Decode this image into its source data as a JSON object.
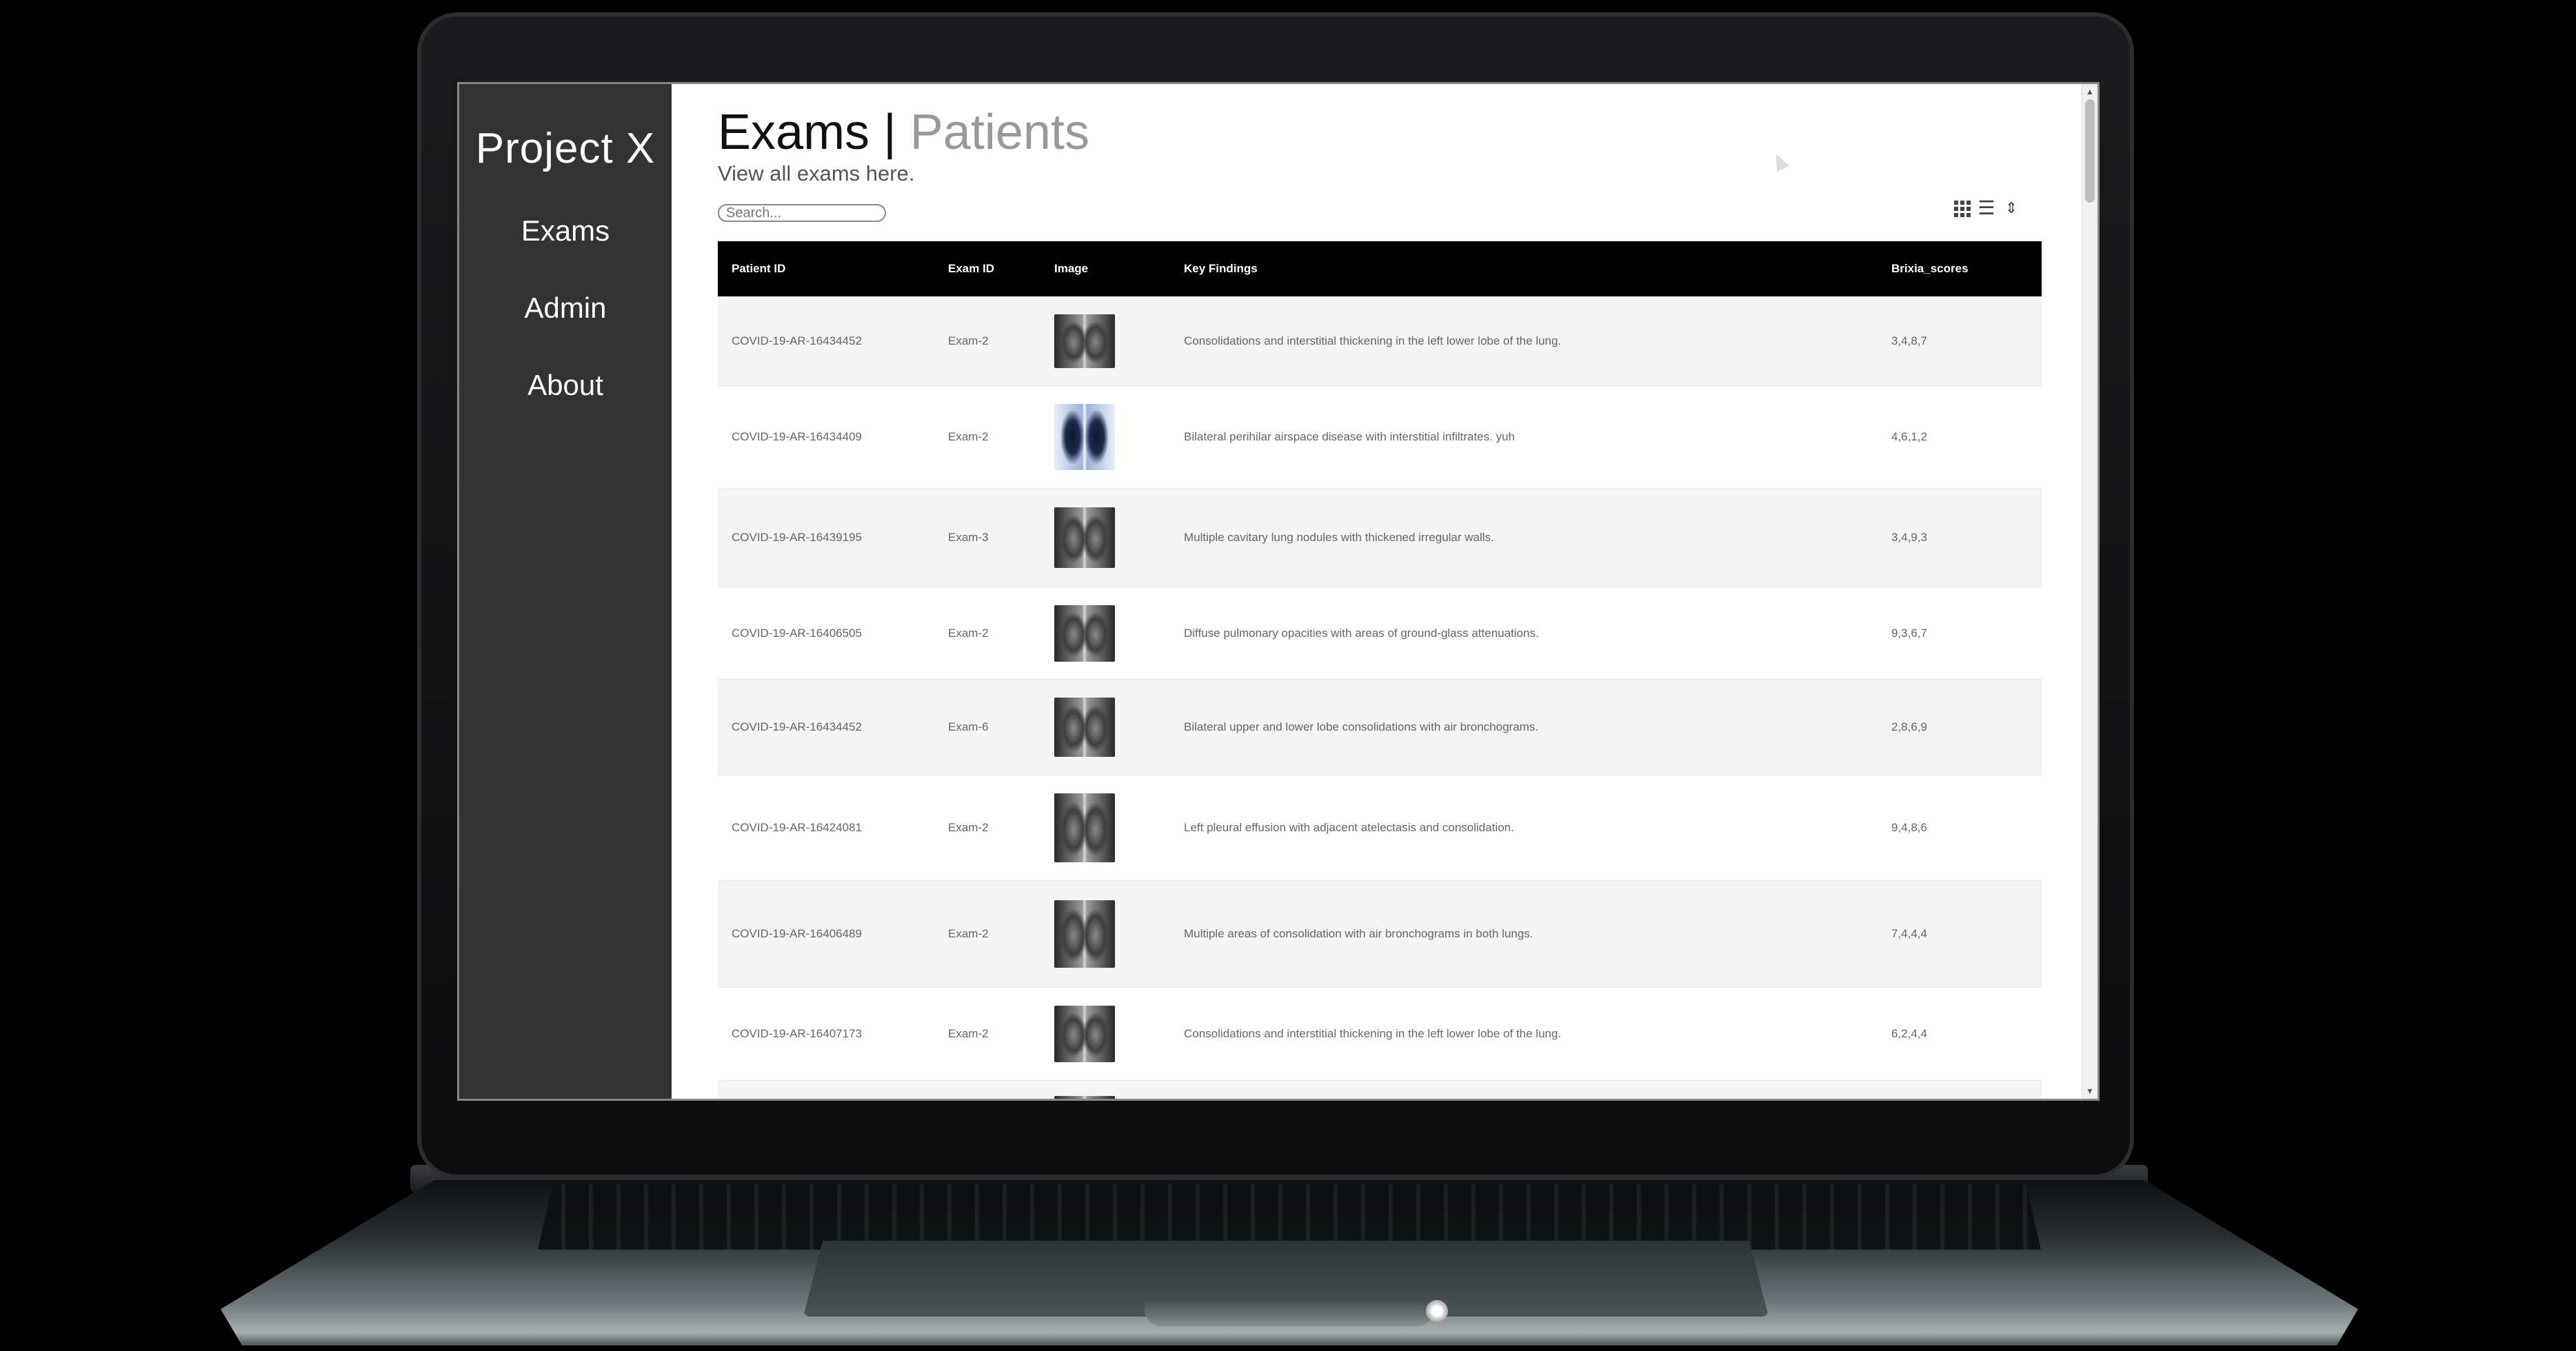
{
  "brand": "Project X",
  "nav": [
    {
      "label": "Exams"
    },
    {
      "label": "Admin"
    },
    {
      "label": "About"
    }
  ],
  "header": {
    "title_active": "Exams",
    "separator": "|",
    "title_inactive": "Patients",
    "subtitle": "View all exams here."
  },
  "search": {
    "placeholder": "Search..."
  },
  "view_toggles": {
    "icons": [
      "grid-icon",
      "list-icon",
      "sort-icon"
    ]
  },
  "table": {
    "columns": [
      "Patient ID",
      "Exam ID",
      "Image",
      "Key Findings",
      "Brixia_scores"
    ],
    "rows": [
      {
        "patient_id": "COVID-19-AR-16434452",
        "exam_id": "Exam-2",
        "findings": "Consolidations and interstitial thickening in the left lower lobe of the lung.",
        "brixia": "3,4,8,7"
      },
      {
        "patient_id": "COVID-19-AR-16434409",
        "exam_id": "Exam-2",
        "findings": "Bilateral perihilar airspace disease with interstitial infiltrates. yuh",
        "brixia": "4,6,1,2"
      },
      {
        "patient_id": "COVID-19-AR-16439195",
        "exam_id": "Exam-3",
        "findings": "Multiple cavitary lung nodules with thickened irregular walls.",
        "brixia": "3,4,9,3"
      },
      {
        "patient_id": "COVID-19-AR-16406505",
        "exam_id": "Exam-2",
        "findings": "Diffuse pulmonary opacities with areas of ground-glass attenuations.",
        "brixia": "9,3,6,7"
      },
      {
        "patient_id": "COVID-19-AR-16434452",
        "exam_id": "Exam-6",
        "findings": "Bilateral upper and lower lobe consolidations with air bronchograms.",
        "brixia": "2,8,6,9"
      },
      {
        "patient_id": "COVID-19-AR-16424081",
        "exam_id": "Exam-2",
        "findings": "Left pleural effusion with adjacent atelectasis and consolidation.",
        "brixia": "9,4,8,6"
      },
      {
        "patient_id": "COVID-19-AR-16406489",
        "exam_id": "Exam-2",
        "findings": "Multiple areas of consolidation with air bronchograms in both lungs.",
        "brixia": "7,4,4,4"
      },
      {
        "patient_id": "COVID-19-AR-16407173",
        "exam_id": "Exam-2",
        "findings": "Consolidations and interstitial thickening in the left lower lobe of the lung.",
        "brixia": "6,2,4,4"
      }
    ]
  },
  "colors": {
    "sidebar_bg": "#333333",
    "table_header_bg": "#000000"
  }
}
